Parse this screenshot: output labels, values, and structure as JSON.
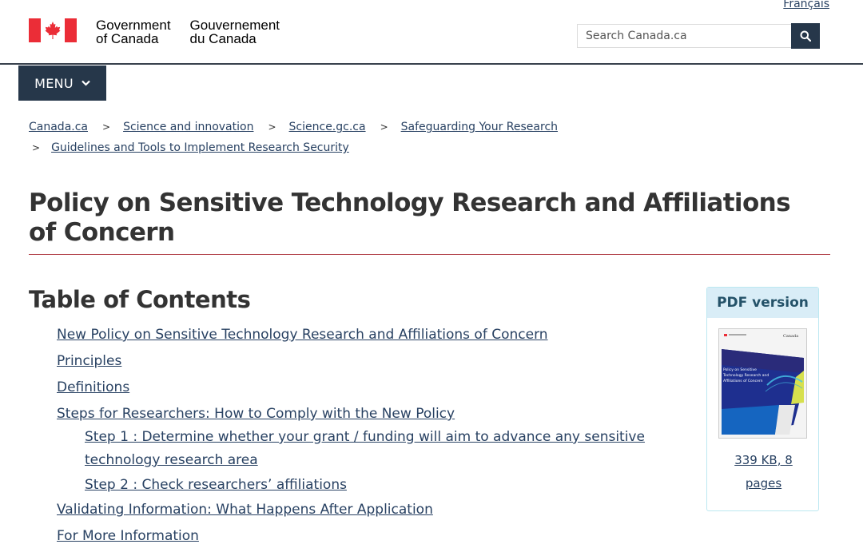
{
  "header": {
    "language_link": "Français",
    "gov_en_line1": "Government",
    "gov_en_line2": "of Canada",
    "gov_fr_line1": "Gouvernement",
    "gov_fr_line2": "du Canada",
    "search_placeholder": "Search Canada.ca",
    "menu_label": "MENU"
  },
  "breadcrumb": [
    "Canada.ca",
    "Science and innovation",
    "Science.gc.ca",
    "Safeguarding Your Research",
    "Guidelines and Tools to Implement Research Security"
  ],
  "page_title": "Policy on Sensitive Technology Research and Affiliations of Concern",
  "toc": {
    "heading": "Table of Contents",
    "items": [
      "New Policy on Sensitive Technology Research and Affiliations of Concern",
      "Principles",
      "Definitions",
      "Steps for Researchers: How to Comply with the New Policy",
      "Step 1 : Determine whether your grant / funding will aim to advance any sensitive technology research area",
      "Step 2 : Check researchers’ affiliations",
      "Validating Information: What Happens After Application",
      "For More Information"
    ]
  },
  "pdf": {
    "heading": "PDF version",
    "cover_title": "Policy on Sensitive Technology Research and Affiliations of Concern",
    "cover_wordmark": "Canada",
    "size_label": "339 KB, 8 pages"
  },
  "colors": {
    "brand_dark": "#26374a",
    "link": "#284162",
    "flag_red": "#eb2d37",
    "title_rule": "#af3c43",
    "pdf_header_bg": "#d9edf7"
  }
}
